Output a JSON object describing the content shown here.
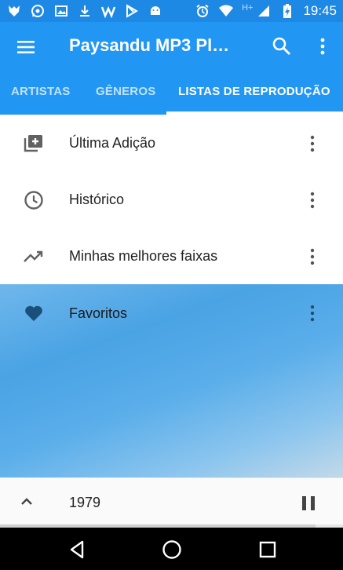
{
  "status_bar": {
    "time": "19:45",
    "network_label": "H+",
    "left_icons": [
      "wolf-app-icon",
      "whatsapp-icon",
      "image-icon",
      "download-icon",
      "w-app-icon",
      "play-store-icon",
      "android-icon"
    ],
    "right_icons": [
      "alarm-icon",
      "wifi-icon",
      "signal-icon",
      "battery-charging-icon"
    ]
  },
  "app_bar": {
    "title": "Paysandu MP3 Pl…",
    "icons": [
      "menu-icon",
      "search-icon",
      "more-vertical-icon"
    ]
  },
  "tabs": [
    {
      "label": "ARTISTAS",
      "active": false
    },
    {
      "label": "GÊNEROS",
      "active": false
    },
    {
      "label": "LISTAS DE REPRODUÇÃO",
      "active": true
    }
  ],
  "playlists": [
    {
      "label": "Última Adição",
      "icon": "playlist-add-icon"
    },
    {
      "label": "Histórico",
      "icon": "clock-icon"
    },
    {
      "label": "Minhas melhores faixas",
      "icon": "trending-up-icon"
    },
    {
      "label": "Favoritos",
      "icon": "heart-icon"
    }
  ],
  "now_playing": {
    "track": "1979",
    "state": "playing",
    "progress": 0.92
  },
  "nav_bar": {
    "buttons": [
      "back-icon",
      "home-icon",
      "recents-icon"
    ]
  },
  "colors": {
    "primary": "#2196f3",
    "status_bar": "#1e88e5",
    "icon_gray": "#616161",
    "heart_dark": "#1a4f7a"
  }
}
